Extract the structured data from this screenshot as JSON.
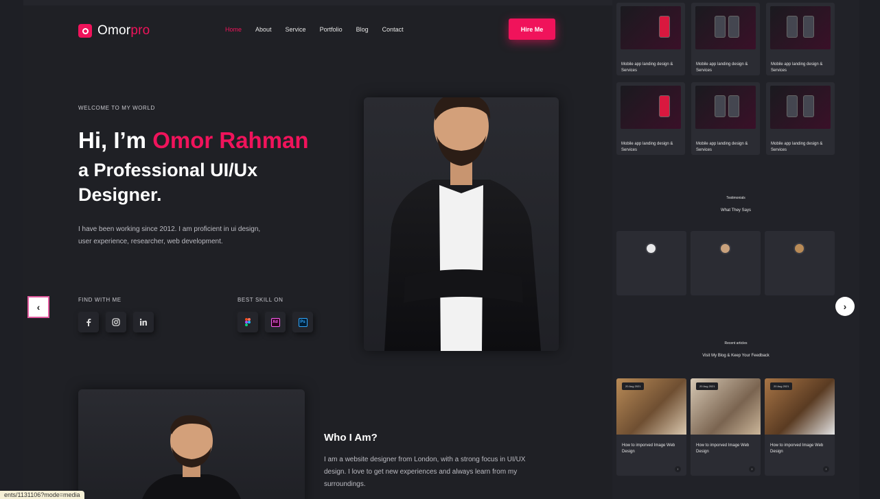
{
  "header": {
    "logo_main": "Omor",
    "logo_accent": "pro",
    "nav": [
      "Home",
      "About",
      "Service",
      "Portfolio",
      "Blog",
      "Contact"
    ],
    "hire_label": "Hire Me"
  },
  "hero": {
    "welcome": "WELCOME TO MY WORLD",
    "greeting": "Hi, I’m ",
    "name": "Omor Rahman",
    "subtitle_line1": "a Professional UI/Ux",
    "subtitle_line2": "Designer.",
    "desc_line1": "I have been working since 2012. I am proficient in ui design,",
    "desc_line2": "user experience, researcher, web development.",
    "find_title": "FIND WITH ME",
    "skill_title": "BEST SKILL ON",
    "socials": [
      "facebook-icon",
      "instagram-icon",
      "linkedin-icon"
    ],
    "skills": [
      "figma-icon",
      "xd-icon",
      "photoshop-icon"
    ],
    "skill_xd": "Xd",
    "skill_ps": "Ps"
  },
  "about": {
    "title": "Who I Am?",
    "text_line1": "I am a website designer from London, with a strong focus in UI/UX",
    "text_line2": "design. I love to get new experiences and always learn from my",
    "text_line3": "surroundings."
  },
  "side": {
    "portfolio_cards": [
      {
        "title": "Mobile app landing design & Services"
      },
      {
        "title": "Mobile app landing design & Services"
      },
      {
        "title": "Mobile app landing design & Services"
      },
      {
        "title": "Mobile app landing design & Services"
      },
      {
        "title": "Mobile app landing design & Services"
      },
      {
        "title": "Mobile app landing design & Services"
      }
    ],
    "testimonials_label": "Testimonials",
    "testimonials_title": "What They Says",
    "articles_label": "Recent articles",
    "articles_title": "Visit My Blog & Keep Your Feedback",
    "articles": [
      {
        "date": "20 Aug 2021",
        "title": "How to imporved Image Web Design"
      },
      {
        "date": "20 Aug 2021",
        "title": "How to imporved Image Web Design"
      },
      {
        "date": "20 Aug 2021",
        "title": "How to imporved Image Web Design"
      }
    ]
  },
  "controls": {
    "prev_glyph": "‹",
    "next_glyph": "›"
  },
  "status_bar": "ents/1131106?mode=media",
  "colors": {
    "accent": "#f0135b",
    "background": "#1f2025"
  }
}
